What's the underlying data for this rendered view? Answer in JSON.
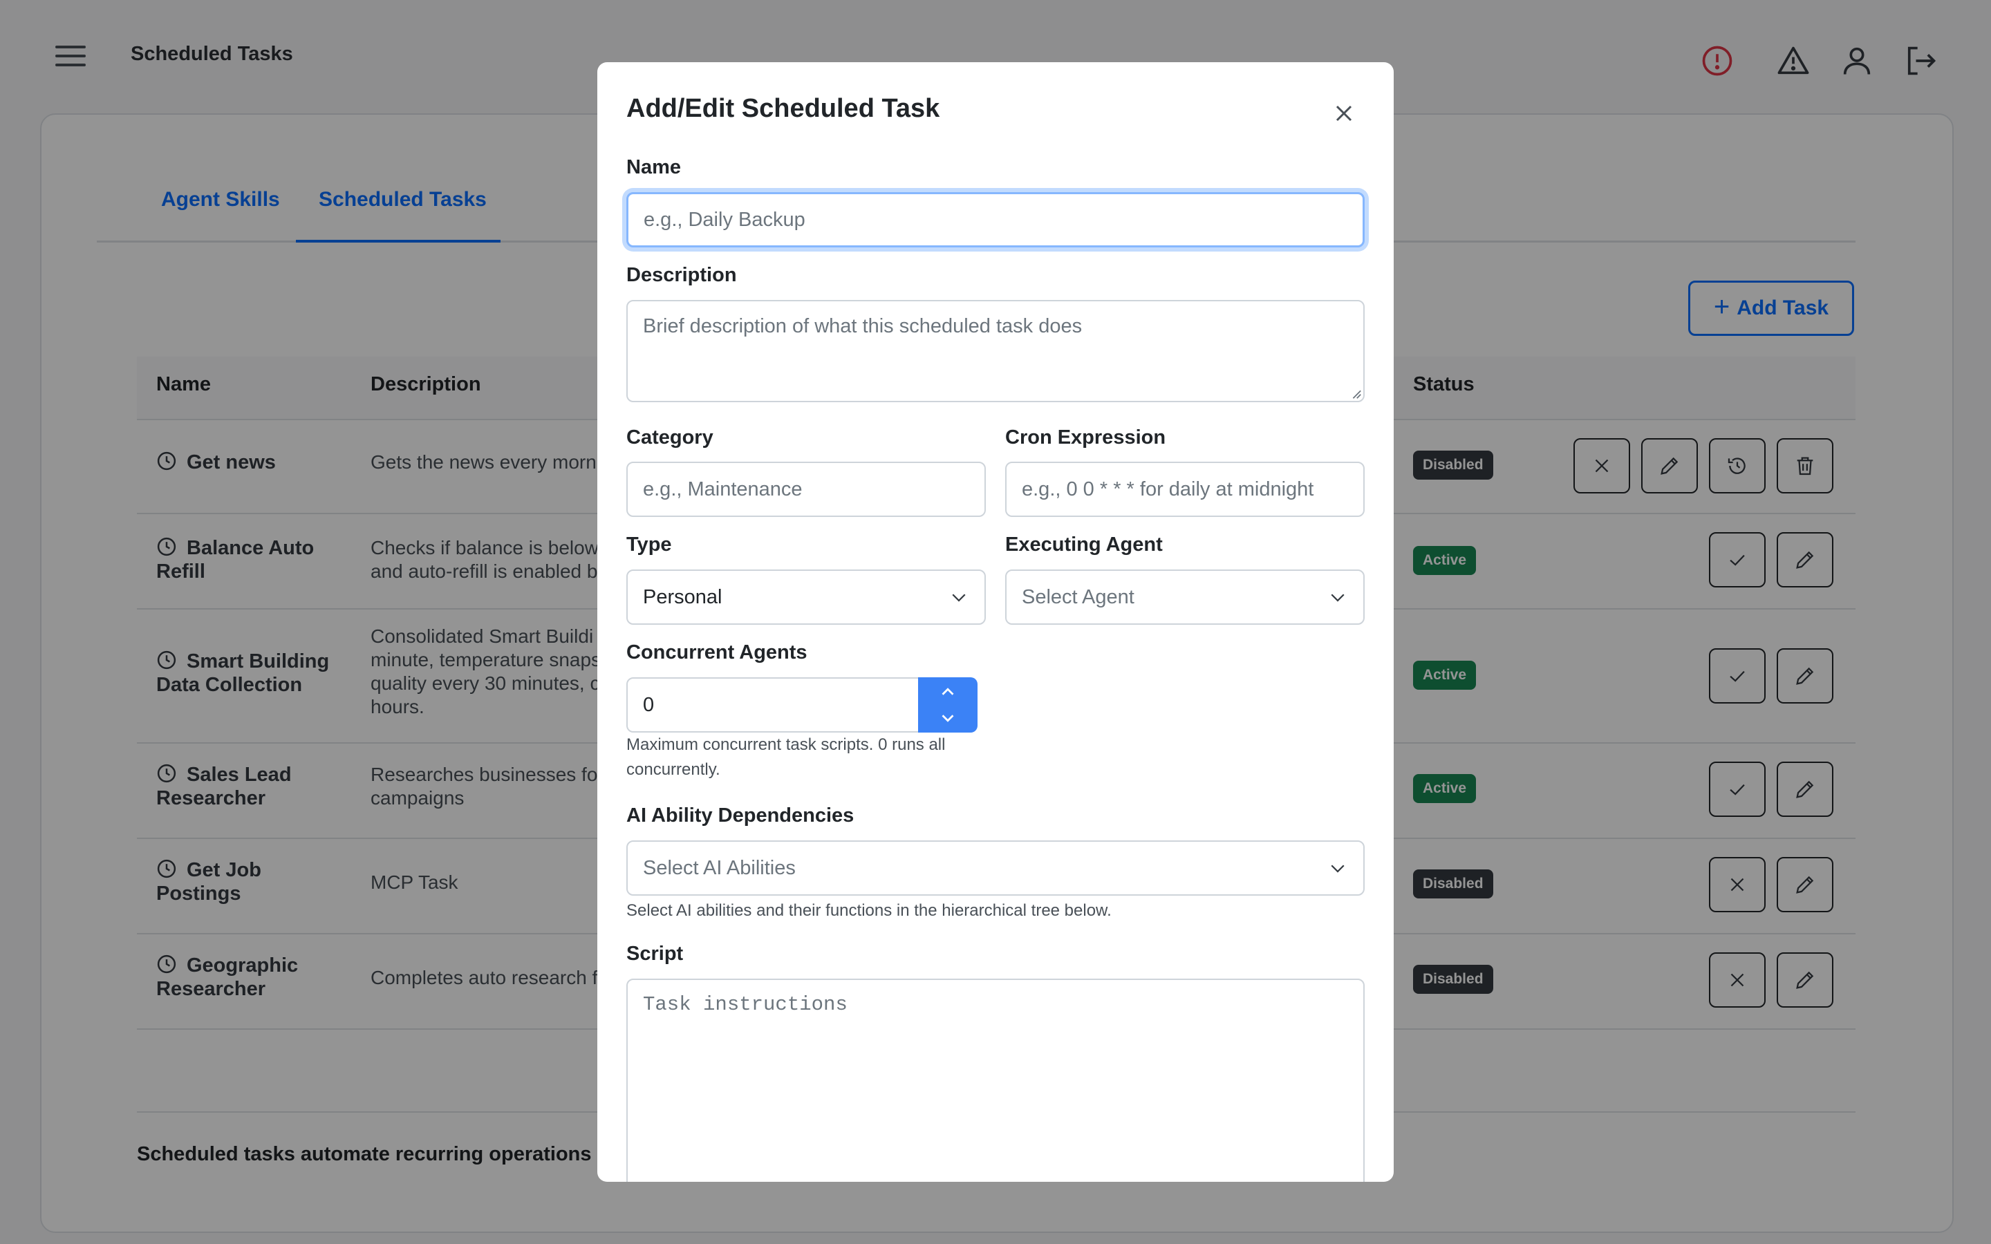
{
  "header": {
    "title": "Scheduled Tasks",
    "icons": [
      "menu-icon",
      "alert-circle-icon",
      "warning-triangle-icon",
      "user-icon",
      "logout-icon"
    ]
  },
  "tabs": [
    {
      "label": "Agent Skills",
      "active": false
    },
    {
      "label": "Scheduled Tasks",
      "active": true
    }
  ],
  "toolbar": {
    "add_task_label": "Add Task"
  },
  "table": {
    "columns": {
      "name": "Name",
      "description": "Description",
      "status": "Status"
    },
    "rows": [
      {
        "name": "Get news",
        "description": "Gets the news every morn",
        "status": "Disabled"
      },
      {
        "name": "Balance Auto Refill",
        "description": "Checks if balance is below\nand auto-refill is enabled b",
        "status": "Active"
      },
      {
        "name": "Smart Building Data Collection",
        "description": "Consolidated Smart Buildi\nminute, temperature snaps\nquality every 30 minutes, c\nhours.",
        "status": "Active"
      },
      {
        "name": "Sales Lead Researcher",
        "description": "Researches businesses fo\ncampaigns",
        "status": "Active"
      },
      {
        "name": "Get Job Postings",
        "description": "MCP Task",
        "status": "Disabled"
      },
      {
        "name": "Geographic Researcher",
        "description": "Completes auto research f",
        "status": "Disabled"
      }
    ]
  },
  "footer": {
    "text": "Scheduled tasks automate recurring operations us"
  },
  "modal": {
    "title": "Add/Edit Scheduled Task",
    "name_label": "Name",
    "name_placeholder": "e.g., Daily Backup",
    "description_label": "Description",
    "description_placeholder": "Brief description of what this scheduled task does",
    "category_label": "Category",
    "category_placeholder": "e.g., Maintenance",
    "cron_label": "Cron Expression",
    "cron_placeholder": "e.g., 0 0 * * * for daily at midnight",
    "type_label": "Type",
    "type_value": "Personal",
    "agent_label": "Executing Agent",
    "agent_placeholder": "Select Agent",
    "concurrent_label": "Concurrent Agents",
    "concurrent_value": "0",
    "concurrent_help": "Maximum concurrent task scripts. 0 runs all concurrently.",
    "ai_label": "AI Ability Dependencies",
    "ai_placeholder": "Select AI Abilities",
    "ai_help": "Select AI abilities and their functions in the hierarchical tree below.",
    "script_label": "Script",
    "script_placeholder": "Task instructions"
  },
  "colors": {
    "accent": "#0d6efd",
    "active_badge": "#198754",
    "disabled_badge": "#343a40",
    "alert_icon": "#dc3545",
    "stepper": "#3b82f6"
  }
}
